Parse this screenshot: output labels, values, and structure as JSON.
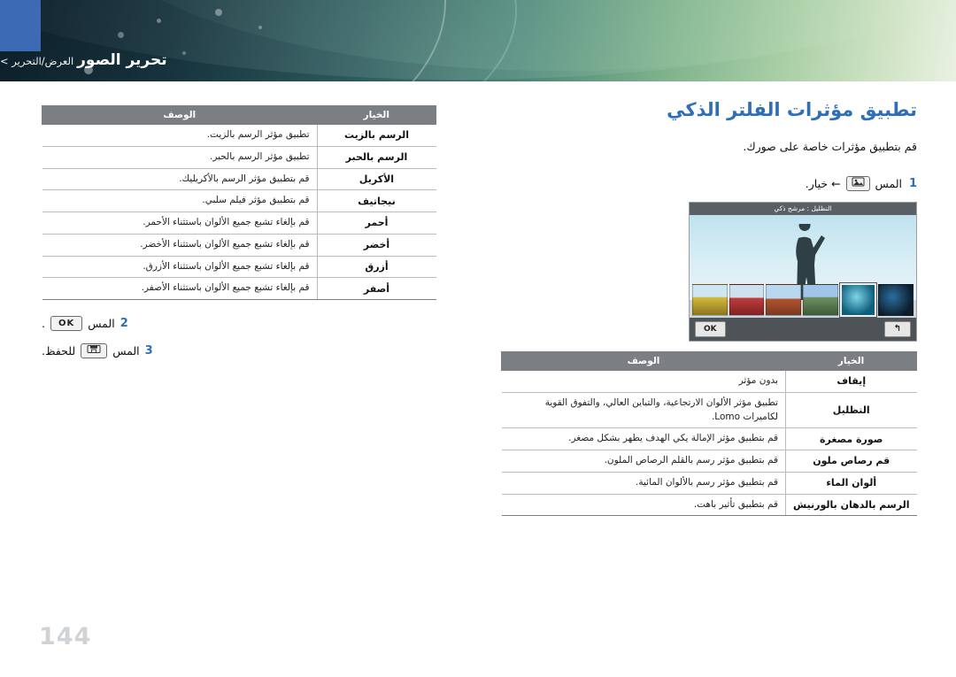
{
  "header": {
    "crumb_main": "تحرير الصور",
    "crumb_sub": "العرض/التحرير >"
  },
  "right": {
    "title": "تطبيق مؤثرات الفلتر الذكي",
    "intro": "قم بتطبيق مؤثرات خاصة على صورك.",
    "step1_num": "1",
    "step1_text": "المس",
    "step1_after": "← خيار.",
    "step1_icon": "smart-filter-icon",
    "lcd": {
      "topbar": "التظليل : مرشح ذكي",
      "back_label": "↰",
      "ok_label": "OK"
    }
  },
  "right_table": {
    "headers": [
      "الخيار",
      "الوصف"
    ],
    "rows": [
      {
        "option": "إيقاف",
        "desc": "بدون مؤثر"
      },
      {
        "option": "التظليل",
        "desc": "تطبيق مؤثر الألوان الارتجاعية، والتباين العالي، والتفوق القوية لكاميرات Lomo."
      },
      {
        "option": "صورة مصغرة",
        "desc": "قم بتطبيق مؤثر الإمالة يكي الهدف يطهر بشكل مصغر."
      },
      {
        "option": "قم رصاص ملون",
        "desc": "قم بتطبيق مؤثر رسم بالقلم الرصاص الملون."
      },
      {
        "option": "ألوان الماء",
        "desc": "قم بتطبيق مؤثر رسم بالألوان المائية."
      },
      {
        "option": "الرسم بالدهان بالورنيش",
        "desc": "قم بتطبيق تأثير باهت."
      }
    ]
  },
  "left_table": {
    "headers": [
      "الخيار",
      "الوصف"
    ],
    "rows": [
      {
        "option": "الرسم بالزيت",
        "desc": "تطبيق مؤثر الرسم بالزيت."
      },
      {
        "option": "الرسم بالحبر",
        "desc": "تطبيق مؤثر الرسم بالحبر."
      },
      {
        "option": "الأكريل",
        "desc": "قم بتطبيق مؤثر الرسم بالأكريليك."
      },
      {
        "option": "نيجاتيف",
        "desc": "قم بتطبيق مؤثر فيلم سلبي."
      },
      {
        "option": "أحمر",
        "desc": "قم بإلغاء تشبع جميع الألوان باستثناء الأحمر."
      },
      {
        "option": "أخضر",
        "desc": "قم بإلغاء تشبع جميع الألوان باستثناء الأخضر."
      },
      {
        "option": "أزرق",
        "desc": "قم بإلغاء تشبع جميع الألوان باستثناء الأزرق."
      },
      {
        "option": "أصفر",
        "desc": "قم بإلغاء تشبع جميع الألوان باستثناء الأصفر."
      }
    ]
  },
  "left_steps": [
    {
      "num": "2",
      "text": "المس",
      "icon": "ok-button-icon",
      "icon_label": "OK",
      "after": "."
    },
    {
      "num": "3",
      "text": "المس",
      "icon": "save-button-icon",
      "icon_label": "▣",
      "after": "للحفظ."
    }
  ],
  "page_number": "144"
}
